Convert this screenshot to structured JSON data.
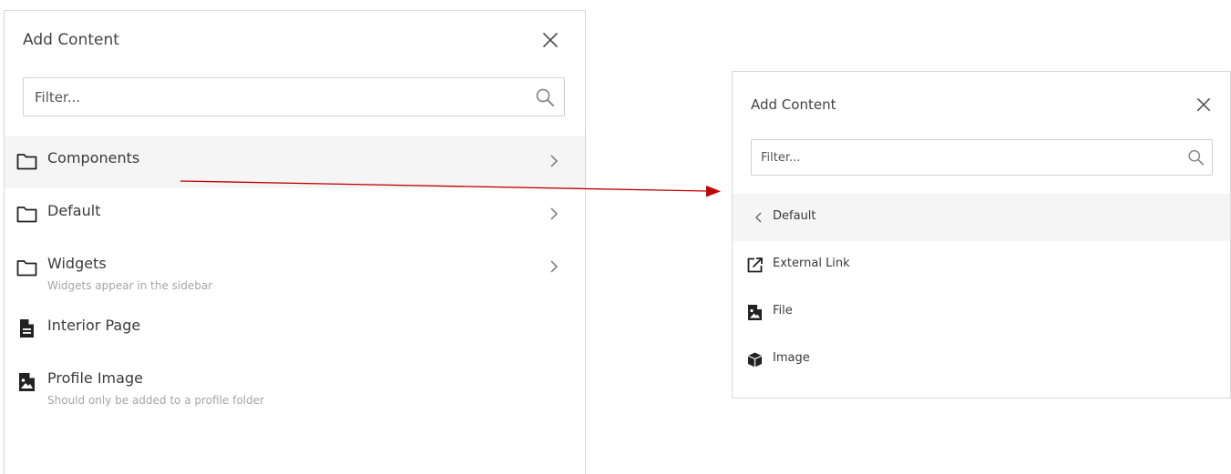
{
  "left_panel": {
    "title": "Add Content",
    "filter_placeholder": "Filter...",
    "items": [
      {
        "label": "Components",
        "icon": "folder-icon",
        "has_chevron": true
      },
      {
        "label": "Default",
        "icon": "folder-icon",
        "has_chevron": true
      },
      {
        "label": "Widgets",
        "description": "Widgets appear in the sidebar",
        "icon": "folder-icon",
        "has_chevron": true
      },
      {
        "label": "Interior Page",
        "icon": "document-icon"
      },
      {
        "label": "Profile Image",
        "description": "Should only be added to a profile folder",
        "icon": "image-file-icon"
      }
    ]
  },
  "right_panel": {
    "title": "Add Content",
    "filter_placeholder": "Filter...",
    "back_label": "Default",
    "items": [
      {
        "label": "External Link",
        "icon": "external-link-icon"
      },
      {
        "label": "File",
        "icon": "image-file-icon"
      },
      {
        "label": "Image",
        "icon": "cube-icon"
      }
    ]
  },
  "colors": {
    "highlight_row": "#f5f5f5",
    "border": "#d9d9d9",
    "arrow": "#c00000",
    "description_text": "#a5a5a5"
  }
}
